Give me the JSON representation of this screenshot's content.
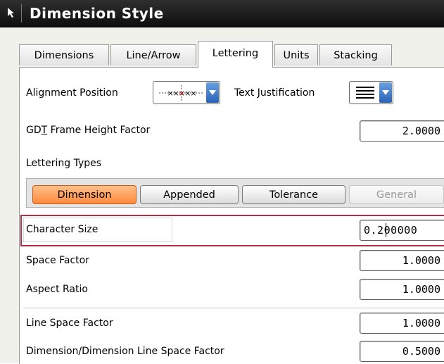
{
  "window": {
    "title": "Dimension Style",
    "icon": "arrow-cursor-icon"
  },
  "tabs": [
    {
      "label": "Dimensions",
      "active": false
    },
    {
      "label": "Line/Arrow",
      "active": false
    },
    {
      "label": "Lettering",
      "active": true
    },
    {
      "label": "Units",
      "active": false
    },
    {
      "label": "Stacking",
      "active": false
    }
  ],
  "alignment": {
    "label": "Alignment Position",
    "icon": "alignment-marker-icon"
  },
  "justification": {
    "label": "Text Justification",
    "icon": "text-lines-icon"
  },
  "gdt": {
    "label_pre": "GD",
    "label_t": "T",
    "label_post": " Frame Height Factor",
    "value": "2.0000"
  },
  "lettering_types": {
    "label": "Lettering Types",
    "buttons": [
      {
        "label": "Dimension",
        "state": "selected"
      },
      {
        "label": "Appended",
        "state": "normal"
      },
      {
        "label": "Tolerance",
        "state": "normal"
      },
      {
        "label": "General",
        "state": "disabled"
      }
    ]
  },
  "fields": {
    "character_size": {
      "label": "Character Size",
      "value": "0.200000"
    },
    "space_factor": {
      "label": "Space Factor",
      "value": "1.0000"
    },
    "aspect_ratio": {
      "label": "Aspect Ratio",
      "value": "1.0000"
    },
    "line_space_factor": {
      "label": "Line Space Factor",
      "value": "1.0000"
    },
    "dim_line_space_factor": {
      "label": "Dimension/Dimension Line Space Factor",
      "value": "0.5000"
    }
  },
  "colors": {
    "selected_button": "#ff8a3d",
    "highlight_border": "#b03048",
    "dropdown_blue": "#3a72c8"
  }
}
